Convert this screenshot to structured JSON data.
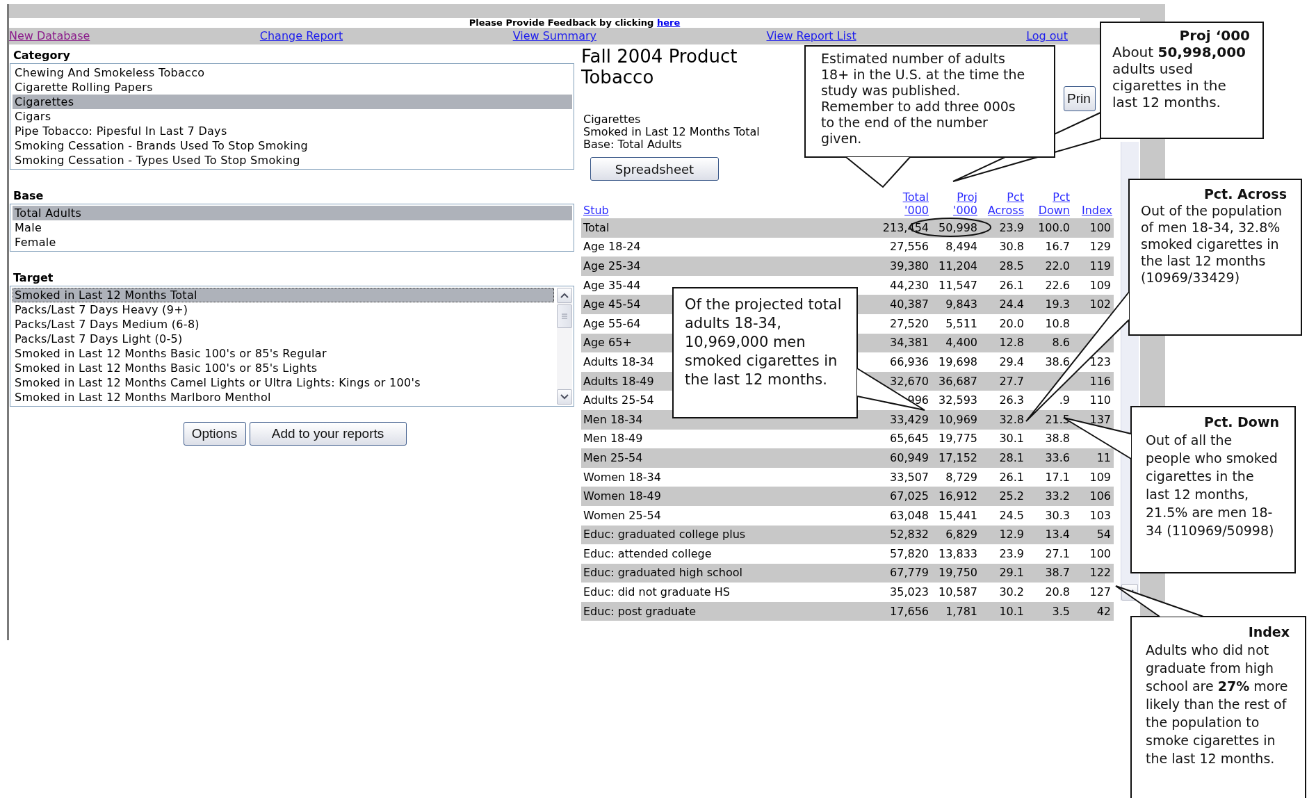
{
  "feedback": {
    "text": "Please Provide Feedback by clicking ",
    "link": "here"
  },
  "nav": [
    {
      "label": "New Database",
      "visited": true
    },
    {
      "label": "Change Report",
      "visited": false
    },
    {
      "label": "View Summary",
      "visited": false
    },
    {
      "label": "View Report List",
      "visited": false
    },
    {
      "label": "Log out",
      "visited": false
    }
  ],
  "category": {
    "label": "Category",
    "items": [
      {
        "label": "Chewing And Smokeless Tobacco",
        "selected": false
      },
      {
        "label": "Cigarette Rolling Papers",
        "selected": false
      },
      {
        "label": "Cigarettes",
        "selected": true
      },
      {
        "label": "Cigars",
        "selected": false
      },
      {
        "label": "Pipe Tobacco: Pipesful In Last 7 Days",
        "selected": false
      },
      {
        "label": "Smoking Cessation - Brands Used To Stop Smoking",
        "selected": false
      },
      {
        "label": "Smoking Cessation - Types Used To Stop Smoking",
        "selected": false
      }
    ]
  },
  "base": {
    "label": "Base",
    "items": [
      {
        "label": "Total Adults",
        "selected": true
      },
      {
        "label": "Male",
        "selected": false
      },
      {
        "label": "Female",
        "selected": false
      }
    ]
  },
  "target": {
    "label": "Target",
    "items": [
      {
        "label": "Smoked in Last 12 Months Total",
        "selected": true
      },
      {
        "label": "Packs/Last 7 Days Heavy (9+)",
        "selected": false
      },
      {
        "label": "Packs/Last 7 Days Medium (6-8)",
        "selected": false
      },
      {
        "label": "Packs/Last 7 Days Light (0-5)",
        "selected": false
      },
      {
        "label": "Smoked in Last 12 Months Basic 100's or 85's Regular",
        "selected": false
      },
      {
        "label": "Smoked in Last 12 Months Basic 100's or 85's Lights",
        "selected": false
      },
      {
        "label": "Smoked in Last 12 Months Camel Lights or Ultra Lights: Kings or 100's",
        "selected": false
      },
      {
        "label": "Smoked in Last 12 Months Marlboro Menthol",
        "selected": false
      }
    ]
  },
  "buttons": [
    "Options",
    "Add to your reports"
  ],
  "report": {
    "title": "Fall 2004 Product Tobacco",
    "lines": [
      "Cigarettes",
      "Smoked in Last 12 Months Total",
      "Base: Total Adults"
    ],
    "spreadsheet_button": "Spreadsheet",
    "print_button": "Prin"
  },
  "table": {
    "columns": [
      "Stub",
      "Total '000",
      "Proj '000",
      "Pct Across",
      "Pct Down",
      "Index"
    ],
    "rows": [
      {
        "shaded": true,
        "cells": [
          "Total",
          "213,454",
          "50,998",
          "23.9",
          "100.0",
          "100"
        ]
      },
      {
        "shaded": false,
        "cells": [
          "Age 18-24",
          "27,556",
          "8,494",
          "30.8",
          "16.7",
          "129"
        ]
      },
      {
        "shaded": true,
        "cells": [
          "Age 25-34",
          "39,380",
          "11,204",
          "28.5",
          "22.0",
          "119"
        ]
      },
      {
        "shaded": false,
        "cells": [
          "Age 35-44",
          "44,230",
          "11,547",
          "26.1",
          "22.6",
          "109"
        ]
      },
      {
        "shaded": true,
        "cells": [
          "Age 45-54",
          "40,387",
          "9,843",
          "24.4",
          "19.3",
          "102"
        ]
      },
      {
        "shaded": false,
        "cells": [
          "Age 55-64",
          "27,520",
          "5,511",
          "20.0",
          "10.8",
          null
        ]
      },
      {
        "shaded": true,
        "cells": [
          "Age 65+",
          "34,381",
          "4,400",
          "12.8",
          "8.6",
          null
        ]
      },
      {
        "shaded": false,
        "cells": [
          "Adults 18-34",
          "66,936",
          "19,698",
          "29.4",
          "38.6",
          "123"
        ]
      },
      {
        "shaded": true,
        "cells": [
          "Adults 18-49",
          "32,670",
          "36,687",
          "27.7",
          null,
          "116"
        ]
      },
      {
        "shaded": false,
        "cells": [
          "Adults 25-54",
          "996",
          "32,593",
          "26.3",
          ".9",
          "110"
        ]
      },
      {
        "shaded": true,
        "cells": [
          "Men 18-34",
          "33,429",
          "10,969",
          "32.8",
          "21.5",
          "137"
        ]
      },
      {
        "shaded": false,
        "cells": [
          "Men 18-49",
          "65,645",
          "19,775",
          "30.1",
          "38.8",
          null
        ]
      },
      {
        "shaded": true,
        "cells": [
          "Men 25-54",
          "60,949",
          "17,152",
          "28.1",
          "33.6",
          "11"
        ]
      },
      {
        "shaded": false,
        "cells": [
          "Women 18-34",
          "33,507",
          "8,729",
          "26.1",
          "17.1",
          "109"
        ]
      },
      {
        "shaded": true,
        "cells": [
          "Women 18-49",
          "67,025",
          "16,912",
          "25.2",
          "33.2",
          "106"
        ]
      },
      {
        "shaded": false,
        "cells": [
          "Women 25-54",
          "63,048",
          "15,441",
          "24.5",
          "30.3",
          "103"
        ]
      },
      {
        "shaded": true,
        "cells": [
          "Educ: graduated college plus",
          "52,832",
          "6,829",
          "12.9",
          "13.4",
          "54"
        ]
      },
      {
        "shaded": false,
        "cells": [
          "Educ: attended college",
          "57,820",
          "13,833",
          "23.9",
          "27.1",
          "100"
        ]
      },
      {
        "shaded": true,
        "cells": [
          "Educ: graduated high school",
          "67,779",
          "19,750",
          "29.1",
          "38.7",
          "122"
        ]
      },
      {
        "shaded": false,
        "cells": [
          "Educ: did not graduate HS",
          "35,023",
          "10,587",
          "30.2",
          "20.8",
          "127"
        ]
      },
      {
        "shaded": true,
        "cells": [
          "Educ: post graduate",
          "17,656",
          "1,781",
          "10.1",
          "3.5",
          "42"
        ]
      }
    ]
  },
  "callouts": [
    {
      "text": "Estimated number of adults 18+ in the U.S. at the time the study was published. Remember to add three 000s to the end of the number given."
    },
    {
      "heading": "Proj ‘000",
      "text": "About **50,998,000** adults used cigarettes in the last 12 months."
    },
    {
      "heading": "Pct. Across",
      "text": "Out of the population of men 18-34, 32.8% smoked cigarettes in the last 12 months (10969/33429)"
    },
    {
      "text": "Of the projected total adults 18-34, 10,969,000 men smoked cigarettes in the last 12 months."
    },
    {
      "heading": "Pct. Down",
      "text": "Out of all the people who smoked cigarettes in the last 12 months, 21.5% are men 18-34 (110969/50998)"
    },
    {
      "heading": "Index",
      "text": "Adults who did not graduate from high school are **27%** more likely than the rest of the population to smoke cigarettes in the last 12 months."
    }
  ]
}
